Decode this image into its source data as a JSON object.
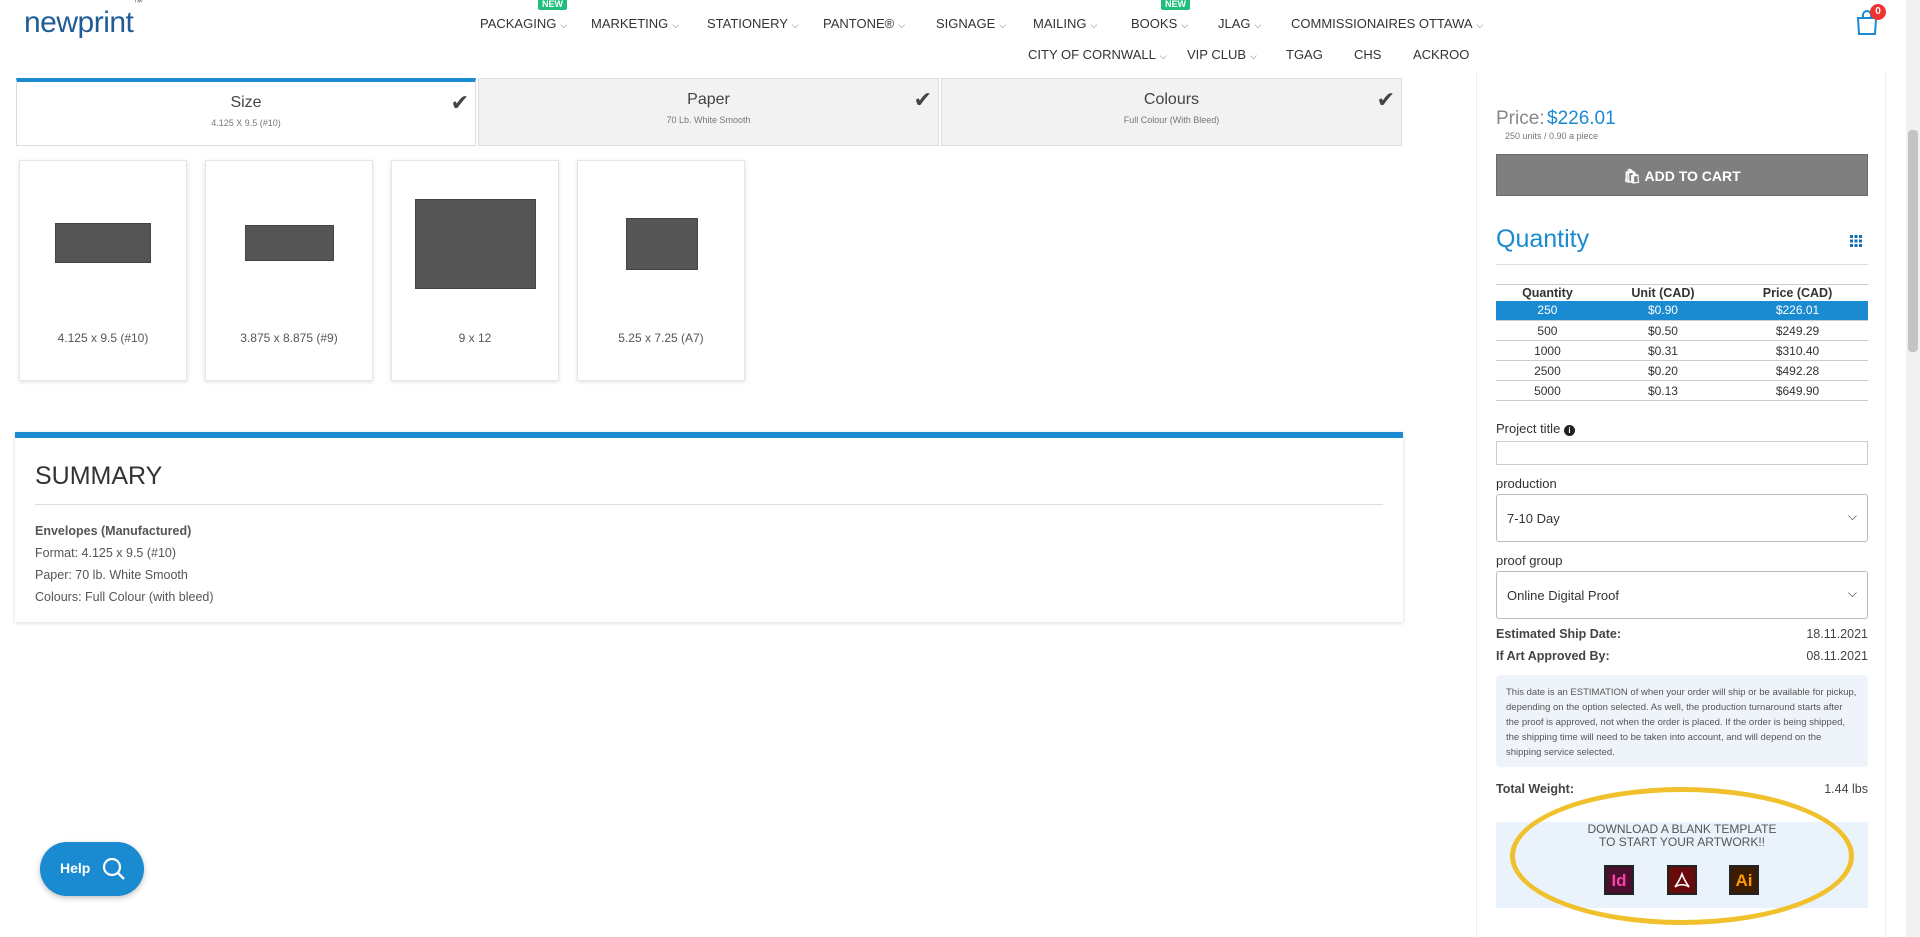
{
  "header": {
    "logo": "newprint",
    "logo_tm": "™",
    "nav_row1": [
      "PACKAGING",
      "MARKETING",
      "STATIONERY",
      "PANTONE®",
      "SIGNAGE",
      "MAILING",
      "BOOKS",
      "JLAG",
      "COMMISSIONAIRES OTTAWA"
    ],
    "nav_row2": [
      "CITY OF CORNWALL",
      "VIP CLUB",
      "TGAG",
      "CHS",
      "ACKROO"
    ],
    "new_badge": "NEW",
    "cart_count": "0"
  },
  "steps": [
    {
      "title": "Size",
      "value": "4.125 X 9.5 (#10)"
    },
    {
      "title": "Paper",
      "value": "70 Lb. White Smooth"
    },
    {
      "title": "Colours",
      "value": "Full Colour (With Bleed)"
    }
  ],
  "sizes": [
    {
      "label": "4.125 x 9.5 (#10)"
    },
    {
      "label": "3.875 x 8.875 (#9)"
    },
    {
      "label": "9 x 12"
    },
    {
      "label": "5.25 x 7.25 (A7)"
    }
  ],
  "summary": {
    "title": "SUMMARY",
    "product": "Envelopes (Manufactured)",
    "format": "Format: 4.125 x 9.5 (#10)",
    "paper": "Paper: 70 lb. White Smooth",
    "colours": "Colours: Full Colour (with bleed)"
  },
  "help": {
    "label": "Help"
  },
  "panel": {
    "price_label": "Price:",
    "price_value": "$226.01",
    "price_sub": "250 units / 0.90 a piece",
    "add_to_cart": "ADD TO CART",
    "quantity_title": "Quantity",
    "table_headers": [
      "Quantity",
      "Unit (CAD)",
      "Price (CAD)"
    ],
    "table_rows": [
      [
        "250",
        "$0.90",
        "$226.01"
      ],
      [
        "500",
        "$0.50",
        "$249.29"
      ],
      [
        "1000",
        "$0.31",
        "$310.40"
      ],
      [
        "2500",
        "$0.20",
        "$492.28"
      ],
      [
        "5000",
        "$0.13",
        "$649.90"
      ]
    ],
    "project_title_label": "Project title",
    "project_title_value": "",
    "production_label": "production",
    "production_value": "7-10 Day",
    "proof_label": "proof group",
    "proof_value": "Online Digital Proof",
    "ship_date_label": "Estimated Ship Date:",
    "ship_date_value": "18.11.2021",
    "art_label": "If Art Approved By:",
    "art_value": "08.11.2021",
    "note": "This date is an ESTIMATION of when your order will ship or be available for pickup, depending on the option selected. As well, the production turnaround starts after the proof is approved, not when the order is placed. If the order is being shipped, the shipping time will need to be taken into account, and will depend on the shipping service selected.",
    "weight_label": "Total Weight:",
    "weight_value": "1.44 lbs",
    "download_line1": "DOWNLOAD A BLANK TEMPLATE",
    "download_line2": "TO START YOUR ARTWORK!!",
    "file_icons": [
      "Id",
      "pdf",
      "Ai"
    ]
  },
  "colors": {
    "accent": "#1a8ad1",
    "highlight_ring": "#f0c02d",
    "new_badge": "#1fbf7a"
  }
}
